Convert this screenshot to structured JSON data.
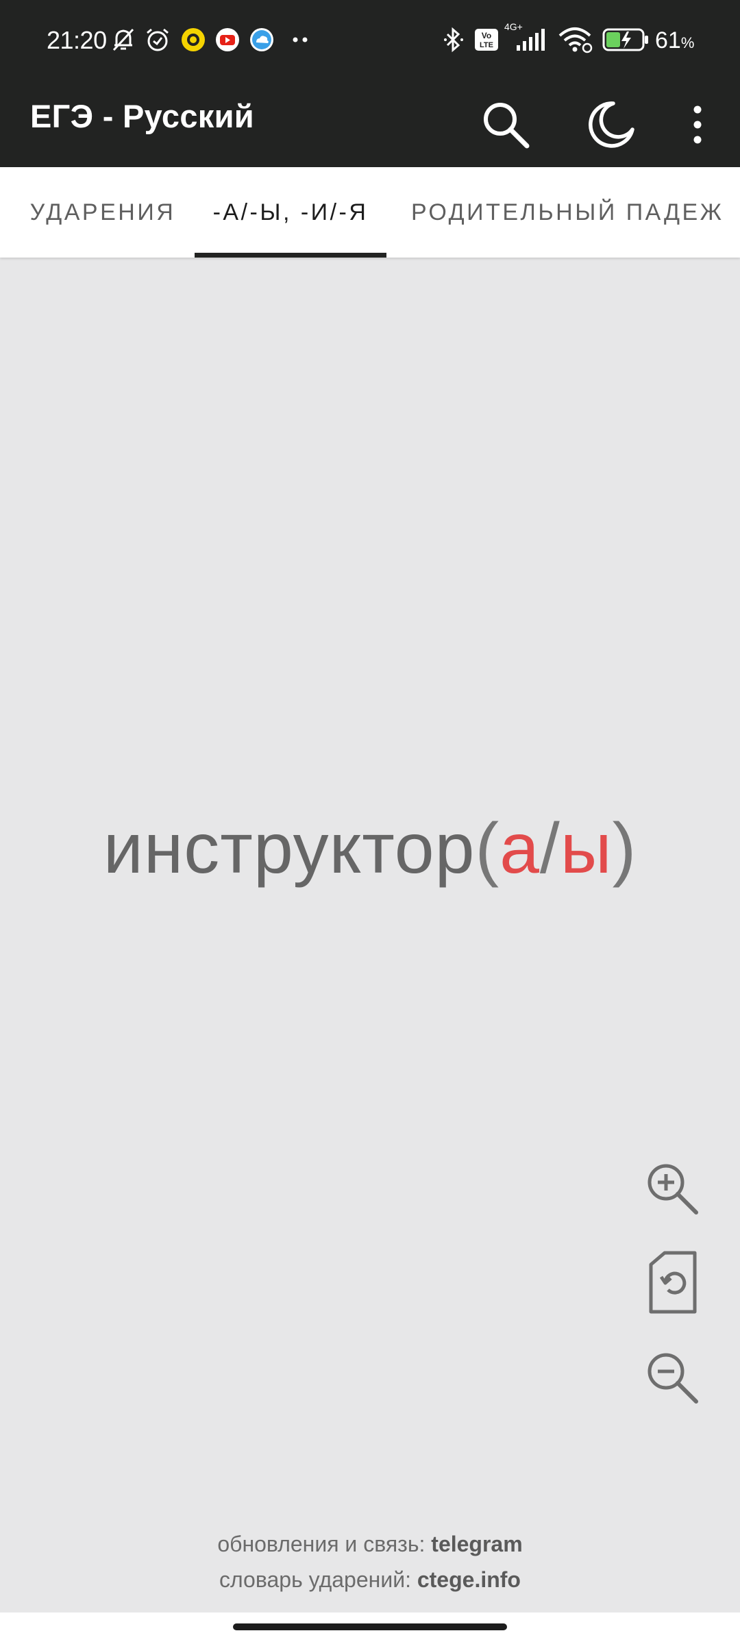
{
  "status_bar": {
    "time": "21:20",
    "network": "4G+",
    "volte": "Vo LTE",
    "battery_percent": "61",
    "battery_unit": "%",
    "icons": [
      "muted-bell-icon",
      "alarm-icon",
      "yellow-ring-app-icon",
      "youtube-icon",
      "cloud-upload-icon",
      "more-dots-icon",
      "bluetooth-icon",
      "volte-icon",
      "signal-icon",
      "wifi-icon",
      "battery-charging-icon"
    ]
  },
  "app_bar": {
    "title": "ЕГЭ - Русский",
    "actions": [
      "search-icon",
      "night-mode-icon",
      "overflow-menu-icon"
    ]
  },
  "tabs": [
    {
      "label": "УДАРЕНИЯ",
      "active": false
    },
    {
      "label": "-А/-Ы, -И/-Я",
      "active": true
    },
    {
      "label": "РОДИТЕЛЬНЫЙ ПАДЕЖ",
      "active": false
    }
  ],
  "card": {
    "word_stem": "инструктор",
    "open_paren": "(",
    "option_a": "а",
    "separator": "/",
    "option_b": "ы",
    "close_paren": ")",
    "accent_color": "#e24b4b"
  },
  "controls": [
    "zoom-in-icon",
    "reset-icon",
    "zoom-out-icon"
  ],
  "footer": {
    "line1_text": "обновления и связь: ",
    "line1_link": "telegram",
    "line2_text": "словарь ударений: ",
    "line2_link": "ctege.info"
  }
}
